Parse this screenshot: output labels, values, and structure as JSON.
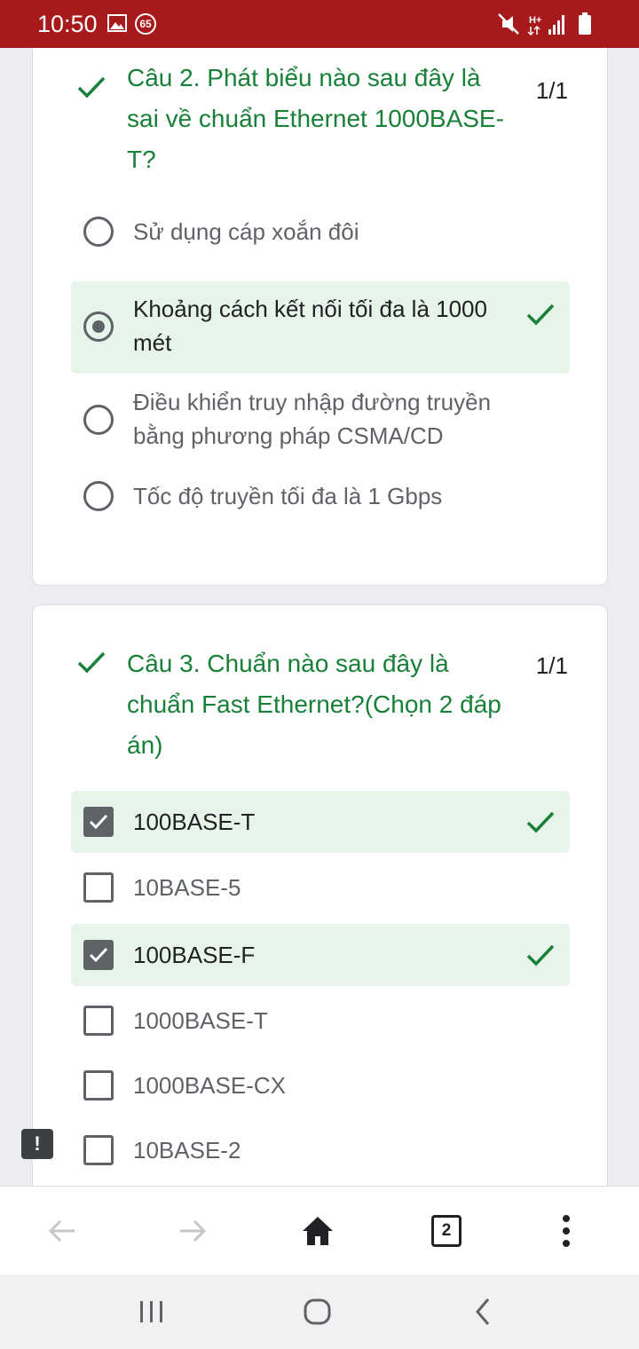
{
  "status_bar": {
    "time": "10:50",
    "notification_count": "65",
    "icons": [
      "image-icon",
      "mute-icon",
      "h-plus-icon",
      "signal-icon",
      "battery-icon"
    ]
  },
  "questions": [
    {
      "title": "Câu 2. Phát biểu nào sau đây là sai về chuẩn Ethernet 1000BASE-T?",
      "score": "1/1",
      "type": "radio",
      "options": [
        {
          "label": "Sử dụng cáp xoắn đôi",
          "selected": false,
          "correct": false
        },
        {
          "label": "Khoảng cách kết nối tối đa là 1000 mét",
          "selected": true,
          "correct": true
        },
        {
          "label": "Điều khiển truy nhập đường truyền bằng phương pháp CSMA/CD",
          "selected": false,
          "correct": false
        },
        {
          "label": "Tốc độ truyền tối đa là 1 Gbps",
          "selected": false,
          "correct": false
        }
      ]
    },
    {
      "title": "Câu 3. Chuẩn nào sau đây là chuẩn Fast Ethernet?(Chọn 2 đáp án)",
      "score": "1/1",
      "type": "checkbox",
      "options": [
        {
          "label": "100BASE-T",
          "selected": true,
          "correct": true
        },
        {
          "label": "10BASE-5",
          "selected": false,
          "correct": false
        },
        {
          "label": "100BASE-F",
          "selected": true,
          "correct": true
        },
        {
          "label": "1000BASE-T",
          "selected": false,
          "correct": false
        },
        {
          "label": "1000BASE-CX",
          "selected": false,
          "correct": false
        },
        {
          "label": "10BASE-2",
          "selected": false,
          "correct": false
        }
      ]
    }
  ],
  "feedback_button": "!",
  "browser_toolbar": {
    "tab_count": "2",
    "icons": [
      "back-arrow-icon",
      "forward-arrow-icon",
      "home-icon",
      "tabs-icon",
      "more-vert-icon"
    ]
  },
  "colors": {
    "status_bar": "#a8191b",
    "correct_green": "#188038",
    "correct_bg": "#e6f4ea",
    "control_gray": "#5f6368"
  }
}
